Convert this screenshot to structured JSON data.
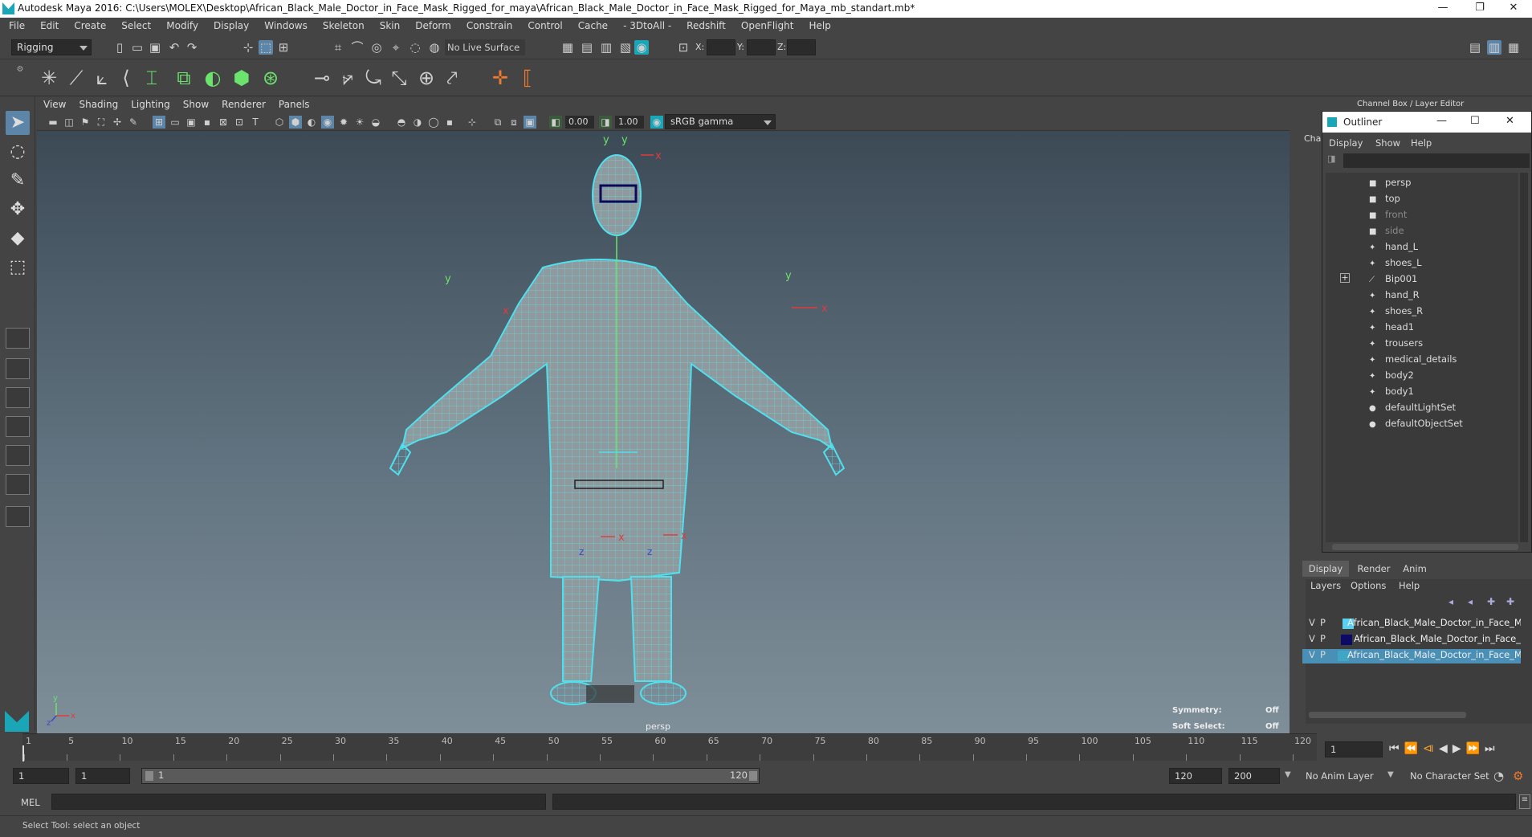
{
  "window": {
    "title": "Autodesk Maya 2016: C:\\Users\\MOLEX\\Desktop\\African_Black_Male_Doctor_in_Face_Mask_Rigged_for_maya\\African_Black_Male_Doctor_in_Face_Mask_Rigged_for_Maya_mb_standart.mb*",
    "minimize": "—",
    "restore": "❐",
    "close": "✕"
  },
  "menubar": [
    "File",
    "Edit",
    "Create",
    "Select",
    "Modify",
    "Display",
    "Windows",
    "Skeleton",
    "Skin",
    "Deform",
    "Constrain",
    "Control",
    "Cache",
    "- 3DtoAll -",
    "Redshift",
    "OpenFlight",
    "Help"
  ],
  "status": {
    "menuset": "Rigging",
    "live_surface": "No Live Surface",
    "x_label": "X:",
    "y_label": "Y:",
    "z_label": "Z:"
  },
  "viewport": {
    "menu": [
      "View",
      "Shading",
      "Lighting",
      "Show",
      "Renderer",
      "Panels"
    ],
    "exposure": "0.00",
    "gamma": "1.00",
    "color_space": "sRGB gamma",
    "camera_label": "persp",
    "symmetry_label": "Symmetry:",
    "symmetry_value": "Off",
    "soft_select_label": "Soft Select:",
    "soft_select_value": "Off",
    "axis": {
      "x": "x",
      "y": "y",
      "z": "z"
    },
    "joint_labels": {
      "x": "x",
      "y": "y",
      "z": "z"
    }
  },
  "channel_box": {
    "title": "Channel Box / Layer Editor",
    "tab_short": "Cha"
  },
  "outliner": {
    "title": "Outliner",
    "menu": [
      "Display",
      "Show",
      "Help"
    ],
    "items": [
      {
        "label": "persp",
        "icon": "camera-icon",
        "dim": false
      },
      {
        "label": "top",
        "icon": "camera-icon",
        "dim": false
      },
      {
        "label": "front",
        "icon": "camera-icon",
        "dim": true
      },
      {
        "label": "side",
        "icon": "camera-icon",
        "dim": true
      },
      {
        "label": "hand_L",
        "icon": "mesh-icon",
        "dim": false
      },
      {
        "label": "shoes_L",
        "icon": "mesh-icon",
        "dim": false
      },
      {
        "label": "Bip001",
        "icon": "joint-icon",
        "dim": false,
        "expandable": true
      },
      {
        "label": "hand_R",
        "icon": "mesh-icon",
        "dim": false
      },
      {
        "label": "shoes_R",
        "icon": "mesh-icon",
        "dim": false
      },
      {
        "label": "head1",
        "icon": "mesh-icon",
        "dim": false
      },
      {
        "label": "trousers",
        "icon": "mesh-icon",
        "dim": false
      },
      {
        "label": "medical_details",
        "icon": "mesh-icon",
        "dim": false
      },
      {
        "label": "body2",
        "icon": "mesh-icon",
        "dim": false
      },
      {
        "label": "body1",
        "icon": "mesh-icon",
        "dim": false
      },
      {
        "label": "defaultLightSet",
        "icon": "set-icon",
        "dim": false
      },
      {
        "label": "defaultObjectSet",
        "icon": "set-icon",
        "dim": false
      }
    ]
  },
  "layer_editor": {
    "tabs": [
      "Display",
      "Render",
      "Anim"
    ],
    "menu": [
      "Layers",
      "Options",
      "Help"
    ],
    "layers": [
      {
        "v": "V",
        "p": "P",
        "color": "#5ad1f0",
        "name": "African_Black_Male_Doctor_in_Face_Mask_",
        "selected": false
      },
      {
        "v": "V",
        "p": "P",
        "color": "#0b0b66",
        "name": "African_Black_Male_Doctor_in_Face_Mas",
        "selected": false
      },
      {
        "v": "V",
        "p": "P",
        "color": "#3fa7c4",
        "name": "African_Black_Male_Doctor_in_Face_Mask_",
        "selected": true
      }
    ]
  },
  "timeline": {
    "ticks": [
      "1",
      "5",
      "10",
      "15",
      "20",
      "25",
      "30",
      "35",
      "40",
      "45",
      "50",
      "55",
      "60",
      "65",
      "70",
      "75",
      "80",
      "85",
      "90",
      "95",
      "100",
      "105",
      "110",
      "115",
      "120"
    ],
    "current_frame": "1"
  },
  "range": {
    "start": "1",
    "playback_start": "1",
    "slider_start": "1",
    "slider_end": "120",
    "playback_end": "120",
    "end": "200",
    "anim_layer": "No Anim Layer",
    "character_set": "No Character Set"
  },
  "command": {
    "lang": "MEL"
  },
  "help_line": "Select Tool: select an object",
  "colors": {
    "wire": "#4fe0ee",
    "selected": "#5c85a8",
    "bg": "#444444"
  }
}
